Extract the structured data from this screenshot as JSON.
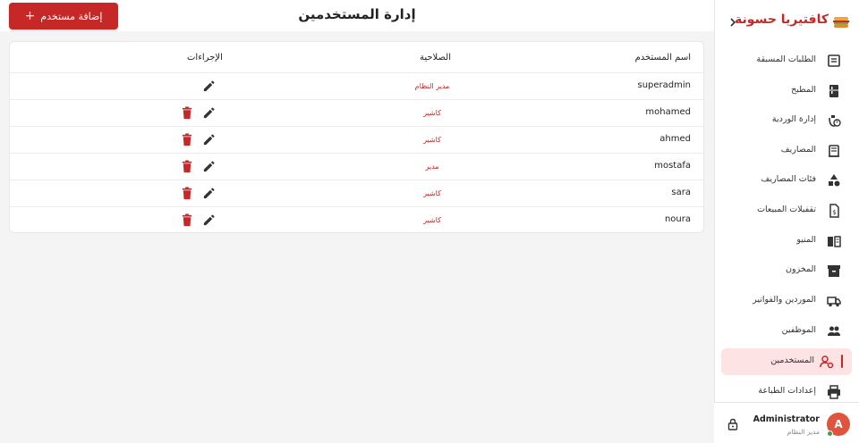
{
  "app": {
    "brand_title": "كافتيريا حسونة",
    "accent_color": "#c62828"
  },
  "header": {
    "title": "إدارة المستخدمين",
    "add_button_label": "إضافة مستخدم",
    "add_button_icon": "plus-icon"
  },
  "table": {
    "columns": [
      "اسم المستخدم",
      "الصلاحية",
      "الإجراءات"
    ],
    "rows": [
      {
        "username": "superadmin",
        "role": "مدير النظام",
        "can_delete": false
      },
      {
        "username": "mohamed",
        "role": "كاشير",
        "can_delete": true
      },
      {
        "username": "ahmed",
        "role": "كاشير",
        "can_delete": true
      },
      {
        "username": "mostafa",
        "role": "مدير",
        "can_delete": true
      },
      {
        "username": "sara",
        "role": "كاشير",
        "can_delete": true
      },
      {
        "username": "noura",
        "role": "كاشير",
        "can_delete": true
      }
    ]
  },
  "sidebar": {
    "items": [
      {
        "label": "الطلبات المسبقة",
        "icon": "pending-orders-icon",
        "active": false
      },
      {
        "label": "المطبخ",
        "icon": "kitchen-icon",
        "active": false
      },
      {
        "label": "إدارة الوردية",
        "icon": "shift-icon",
        "active": false
      },
      {
        "label": "المصاريف",
        "icon": "receipt-icon",
        "active": false
      },
      {
        "label": "فئات المصاريف",
        "icon": "category-icon",
        "active": false
      },
      {
        "label": "تقفيلات المبيعات",
        "icon": "sales-closing-icon",
        "active": false
      },
      {
        "label": "المنيو",
        "icon": "menu-book-icon",
        "active": false
      },
      {
        "label": "المخزون",
        "icon": "inventory-icon",
        "active": false
      },
      {
        "label": "الموردين والفواتير",
        "icon": "truck-icon",
        "active": false
      },
      {
        "label": "الموظفين",
        "icon": "people-icon",
        "active": false
      },
      {
        "label": "المستخدمين",
        "icon": "user-settings-icon",
        "active": true
      },
      {
        "label": "إعدادات الطباعة",
        "icon": "printer-icon",
        "active": false
      }
    ]
  },
  "user": {
    "avatar_letter": "A",
    "name": "Administrator",
    "role": "مدير النظام"
  }
}
